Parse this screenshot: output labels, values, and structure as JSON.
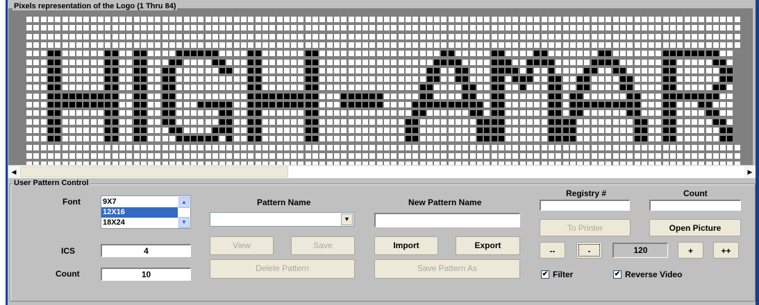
{
  "pixel_group": {
    "title": "Pixels representation of the Logo (1 Thru 84)",
    "logo_rows": [
      "....................................................................................................",
      "....................................................................................................",
      "....................................................................................................",
      "....................................................................................................",
      "...##......##..##....######....##......##.................##.....##....##.......##.......########..",
      "...##......##..##...##....##...##......##................####....###..####.....####......##.....##.",
      "...##......##..##..##......##..##......##...............##..##...####.#..#....##..##.....##......##",
      "...##......##..##..##..........##......##...............##..##...##.###..##..##....##....##......##",
      "...##......##..##..##..........##......##..............##....##..##..#...##..##....##....##.....##.",
      "...##########..##..##..........##########...######.....##....##..##......##.##......##...########..",
      "...##########..##..##...#####..##########...######....##########.##......##.##########...##...##...",
      "...##......##..##..##......##..##......##.............##......##.##......##.##......##...##....##..",
      "...##......##..##..##......##..##......##............##........####......####........##..##.....##.",
      "...##......##..##...##....###..##......##............##........####......####........##..##......##",
      "...##......##..##....######.#..##......##............##........####......####........##..##......##",
      "....................................................................................................",
      "....................................................................................................",
      "...................................................................................................."
    ]
  },
  "pattern_group": {
    "title": "User Pattern Control",
    "font_label": "Font",
    "font_options": [
      "9X7",
      "12X16",
      "18X24"
    ],
    "font_selected": "12X16",
    "ics_label": "ICS",
    "ics_value": "4",
    "count_label": "Count",
    "count_value": "10",
    "pattern_name_label": "Pattern Name",
    "pattern_name_value": "",
    "new_pattern_name_label": "New Pattern Name",
    "new_pattern_name_value": "",
    "registry_label": "Registry #",
    "registry_value": "",
    "count2_label": "Count",
    "count2_value": "",
    "buttons": {
      "view": "View",
      "save": "Save",
      "import": "Import",
      "export": "Export",
      "delete_pattern": "Delete Pattern",
      "save_pattern_as": "Save Pattern As",
      "to_printer": "To Printer",
      "open_picture": "Open Picture",
      "minus_minus": "--",
      "minus": "-",
      "plus": "+",
      "plus_plus": "++"
    },
    "stepper_value": "120",
    "filter_label": "Filter",
    "filter_checked": true,
    "reverse_video_label": "Reverse Video",
    "reverse_video_checked": true
  },
  "scrollbar": {
    "position_fraction": 0.0
  }
}
